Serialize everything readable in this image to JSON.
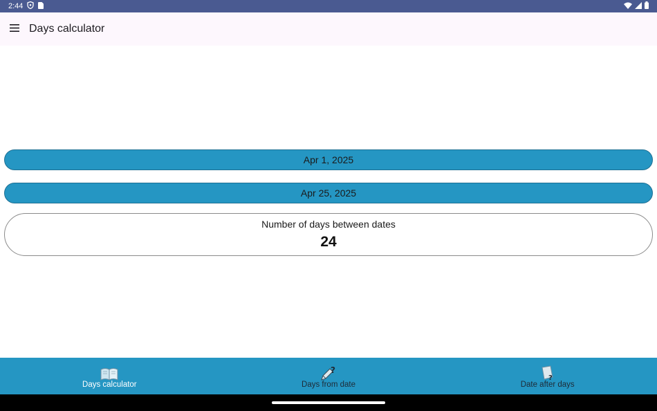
{
  "status_bar": {
    "time": "2:44",
    "icons": [
      "shield-icon",
      "sim-card-icon",
      "wifi-icon",
      "signal-icon",
      "battery-icon"
    ]
  },
  "app_bar": {
    "title": "Days calculator",
    "menu_icon": "hamburger-menu-icon"
  },
  "dates": {
    "start": "Apr 1, 2025",
    "end": "Apr 25, 2025"
  },
  "result": {
    "label": "Number of days between dates",
    "value": "24"
  },
  "bottom_nav": {
    "items": [
      {
        "label": "Days calculator",
        "icon": "open-book-icon",
        "active": true
      },
      {
        "label": "Days from date",
        "icon": "pen-question-icon",
        "active": false
      },
      {
        "label": "Date after days",
        "icon": "page-question-icon",
        "active": false
      }
    ]
  },
  "colors": {
    "status_bar": "#4a5a91",
    "accent": "#2596c3",
    "app_bar": "#fdf7fd"
  }
}
